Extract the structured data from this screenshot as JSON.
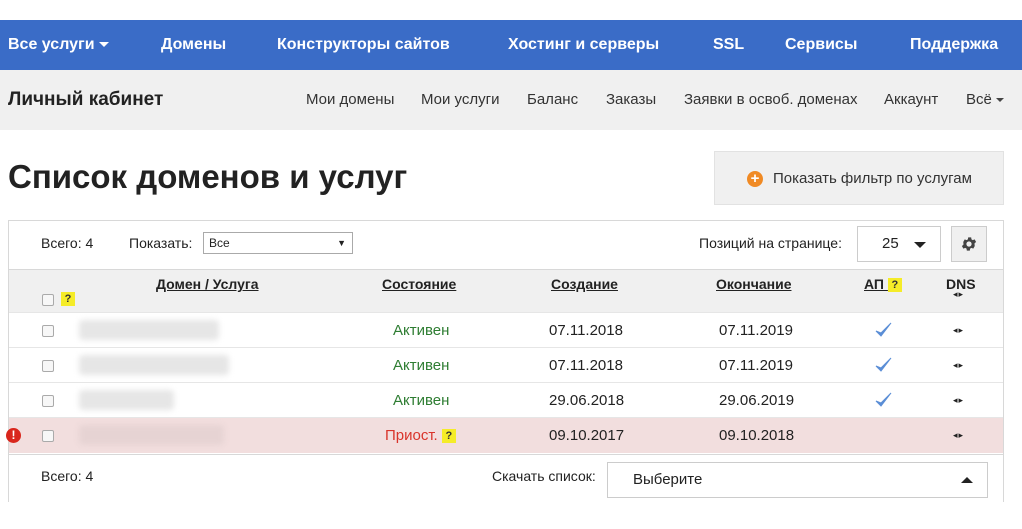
{
  "topnav": {
    "all_services": "Все услуги",
    "items": [
      "Домены",
      "Конструкторы сайтов",
      "Хостинг и серверы",
      "SSL",
      "Сервисы",
      "Поддержка"
    ]
  },
  "subnav": {
    "brand": "Личный кабинет",
    "links": [
      "Мои домены",
      "Мои услуги",
      "Баланс",
      "Заказы",
      "Заявки в освоб. доменах",
      "Аккаунт"
    ],
    "more": "Всё"
  },
  "page_title": "Список доменов и услуг",
  "filter_button": "Показать фильтр по услугам",
  "toolbar": {
    "total": "Всего: 4",
    "show_label": "Показать:",
    "show_value": "Все",
    "per_page_label": "Позиций на странице:",
    "per_page_value": "25"
  },
  "table": {
    "headers": {
      "domain": "Домен / Услуга",
      "state": "Состояние",
      "created": "Создание",
      "expires": "Окончание",
      "ap": "АП",
      "dns": "DNS"
    },
    "help_mark": "?",
    "dns_glyph": "◂▸",
    "rows": [
      {
        "state": "Активен",
        "created": "07.11.2018",
        "expires": "07.11.2019",
        "autorenew": true
      },
      {
        "state": "Активен",
        "created": "07.11.2018",
        "expires": "07.11.2019",
        "autorenew": true
      },
      {
        "state": "Активен",
        "created": "29.06.2018",
        "expires": "29.06.2019",
        "autorenew": true
      },
      {
        "state": "Приост.",
        "created": "09.10.2017",
        "expires": "09.10.2018",
        "autorenew": false
      }
    ]
  },
  "footer": {
    "total": "Всего: 4",
    "download_label": "Скачать список:",
    "download_value": "Выберите"
  },
  "colors": {
    "nav_blue": "#3a6cc7",
    "active_green": "#2e7d32",
    "suspended_red": "#d9342b",
    "suspended_row_bg": "#f2dede",
    "help_yellow": "#f5ec28",
    "filter_orange": "#f08a24"
  }
}
